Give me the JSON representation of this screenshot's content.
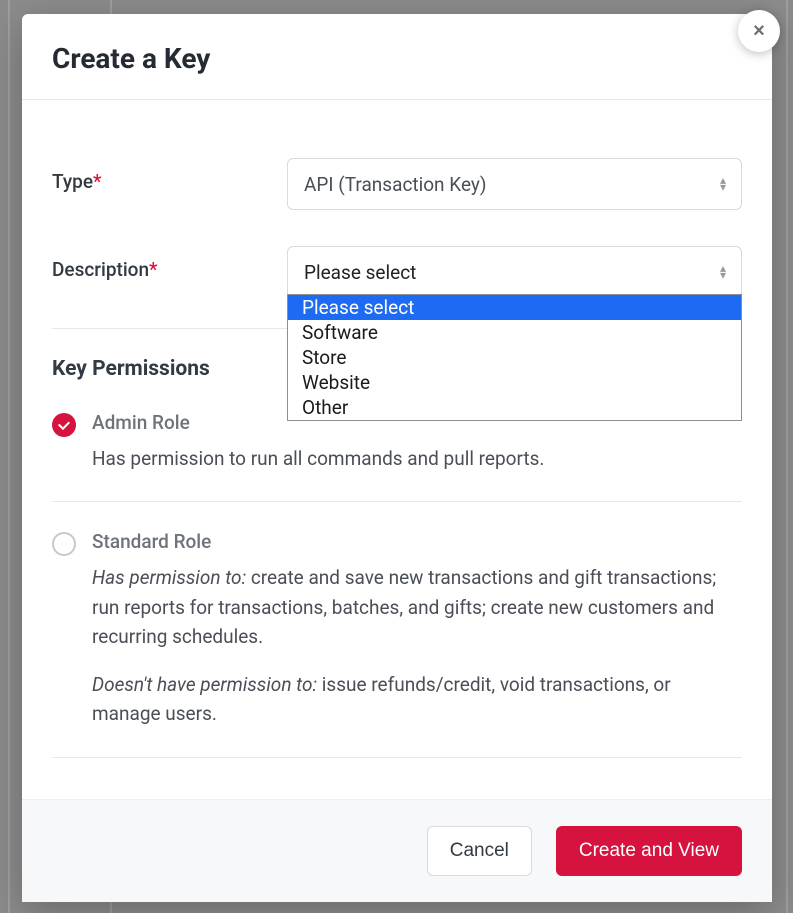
{
  "modal": {
    "title": "Create a Key",
    "close_icon": "×"
  },
  "form": {
    "type_label": "Type",
    "type_value": "API (Transaction Key)",
    "description_label": "Description",
    "description_value": "Please select",
    "description_options": [
      "Please select",
      "Software",
      "Store",
      "Website",
      "Other"
    ],
    "required_marker": "*"
  },
  "permissions": {
    "section_title": "Key Permissions",
    "admin": {
      "title": "Admin Role",
      "desc": "Has permission to run all commands and pull reports.",
      "checked": true
    },
    "standard": {
      "title": "Standard Role",
      "has_label": "Has permission to:",
      "has_text": " create and save new transactions and gift transactions; run reports for transactions, batches, and gifts; create new customers and recurring schedules.",
      "hasnt_label": "Doesn't have permission to:",
      "hasnt_text": " issue refunds/credit, void transactions, or manage users.",
      "checked": false
    }
  },
  "footer": {
    "cancel": "Cancel",
    "submit": "Create and View"
  }
}
